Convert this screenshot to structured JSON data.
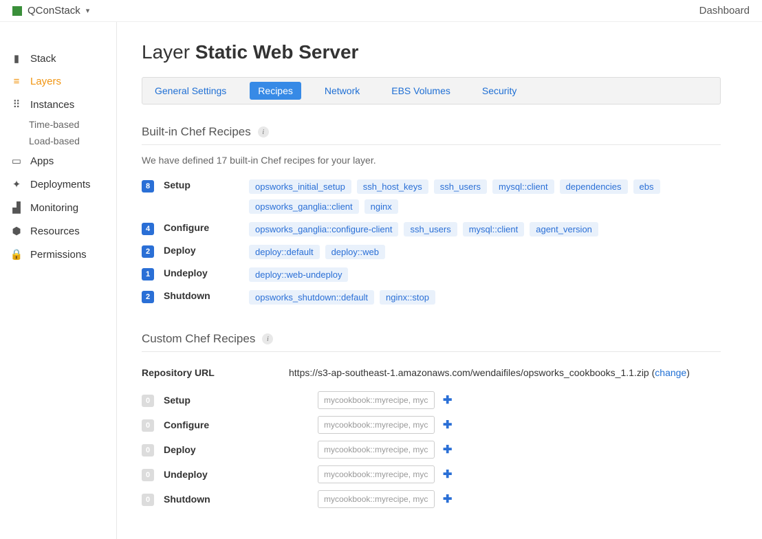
{
  "topbar": {
    "stack_name": "QConStack",
    "dashboard": "Dashboard"
  },
  "sidebar": {
    "items": [
      {
        "label": "Stack"
      },
      {
        "label": "Layers"
      },
      {
        "label": "Instances"
      },
      {
        "label": "Apps"
      },
      {
        "label": "Deployments"
      },
      {
        "label": "Monitoring"
      },
      {
        "label": "Resources"
      },
      {
        "label": "Permissions"
      }
    ],
    "instances_sub": [
      {
        "label": "Time-based"
      },
      {
        "label": "Load-based"
      }
    ]
  },
  "page": {
    "title_prefix": "Layer ",
    "title_name": "Static Web Server"
  },
  "tabs": [
    {
      "label": "General Settings"
    },
    {
      "label": "Recipes"
    },
    {
      "label": "Network"
    },
    {
      "label": "EBS Volumes"
    },
    {
      "label": "Security"
    }
  ],
  "builtin": {
    "heading": "Built-in Chef Recipes",
    "description": "We have defined 17 built-in Chef recipes for your layer.",
    "rows": [
      {
        "count": "8",
        "label": "Setup",
        "tags": [
          "opsworks_initial_setup",
          "ssh_host_keys",
          "ssh_users",
          "mysql::client",
          "dependencies",
          "ebs",
          "opsworks_ganglia::client",
          "nginx"
        ]
      },
      {
        "count": "4",
        "label": "Configure",
        "tags": [
          "opsworks_ganglia::configure-client",
          "ssh_users",
          "mysql::client",
          "agent_version"
        ]
      },
      {
        "count": "2",
        "label": "Deploy",
        "tags": [
          "deploy::default",
          "deploy::web"
        ]
      },
      {
        "count": "1",
        "label": "Undeploy",
        "tags": [
          "deploy::web-undeploy"
        ]
      },
      {
        "count": "2",
        "label": "Shutdown",
        "tags": [
          "opsworks_shutdown::default",
          "nginx::stop"
        ]
      }
    ]
  },
  "custom": {
    "heading": "Custom Chef Recipes",
    "repo_label": "Repository URL",
    "repo_url": "https://s3-ap-southeast-1.amazonaws.com/wendaifiles/opsworks_cookbooks_1.1.zip",
    "change_text": "change",
    "input_placeholder": "mycookbook::myrecipe, mycookbook",
    "rows": [
      {
        "count": "0",
        "label": "Setup"
      },
      {
        "count": "0",
        "label": "Configure"
      },
      {
        "count": "0",
        "label": "Deploy"
      },
      {
        "count": "0",
        "label": "Undeploy"
      },
      {
        "count": "0",
        "label": "Shutdown"
      }
    ]
  }
}
